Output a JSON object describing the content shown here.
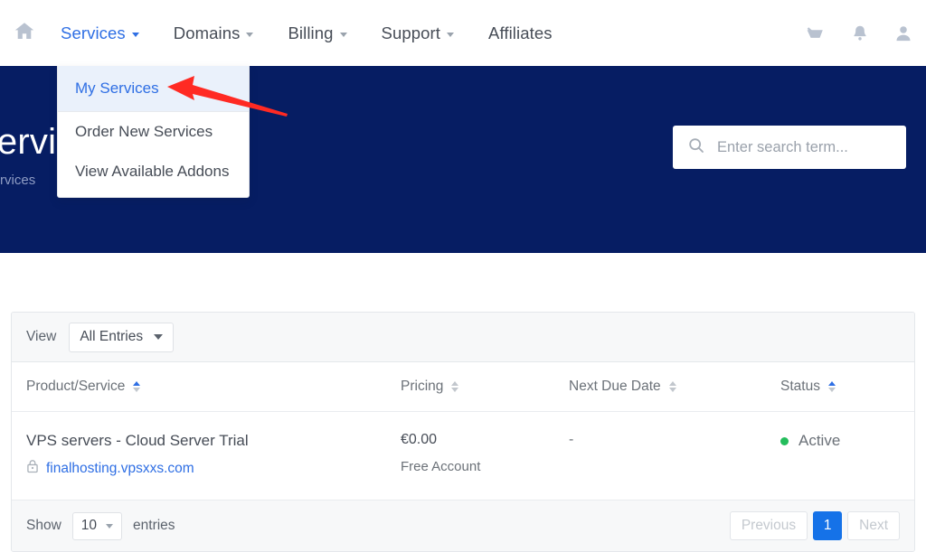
{
  "nav": {
    "home_icon": "home-icon",
    "items": [
      {
        "label": "Services",
        "has_caret": true,
        "active": true
      },
      {
        "label": "Domains",
        "has_caret": true,
        "active": false
      },
      {
        "label": "Billing",
        "has_caret": true,
        "active": false
      },
      {
        "label": "Support",
        "has_caret": true,
        "active": false
      },
      {
        "label": "Affiliates",
        "has_caret": false,
        "active": false
      }
    ],
    "right_icons": [
      {
        "name": "shopping-cart-icon"
      },
      {
        "name": "notification-bell-icon"
      },
      {
        "name": "user-account-icon"
      }
    ]
  },
  "dropdown": {
    "items": [
      {
        "label": "My Services",
        "selected": true
      },
      {
        "label": "Order New Services",
        "selected": false
      },
      {
        "label": "View Available Addons",
        "selected": false
      }
    ]
  },
  "banner": {
    "title": "My Services",
    "subtitle": "Home / My Services",
    "background_color": "#061d63"
  },
  "search": {
    "placeholder": "Enter search term...",
    "value": "",
    "icon": "search-icon"
  },
  "filter": {
    "view_label": "View",
    "selected": "All Entries"
  },
  "table": {
    "columns": [
      {
        "label": "Product/Service",
        "sorted": "asc"
      },
      {
        "label": "Pricing",
        "sorted": "none"
      },
      {
        "label": "Next Due Date",
        "sorted": "none"
      },
      {
        "label": "Status",
        "sorted": "asc"
      }
    ],
    "rows": [
      {
        "product": "VPS servers - Cloud Server Trial",
        "domain": "finalhosting.vpsxxs.com",
        "domain_icon": "lock-icon",
        "price": "€0.00",
        "price_note": "Free Account",
        "due_date": "-",
        "status": "Active",
        "status_color": "#24bd5c"
      }
    ]
  },
  "footer": {
    "show_label": "Show",
    "entries_count": "10",
    "entries_label": "entries",
    "pagination": {
      "previous": "Previous",
      "current": "1",
      "next": "Next"
    }
  },
  "annotation": {
    "arrow_color": "#ff2a23",
    "points_at": "My Services"
  }
}
